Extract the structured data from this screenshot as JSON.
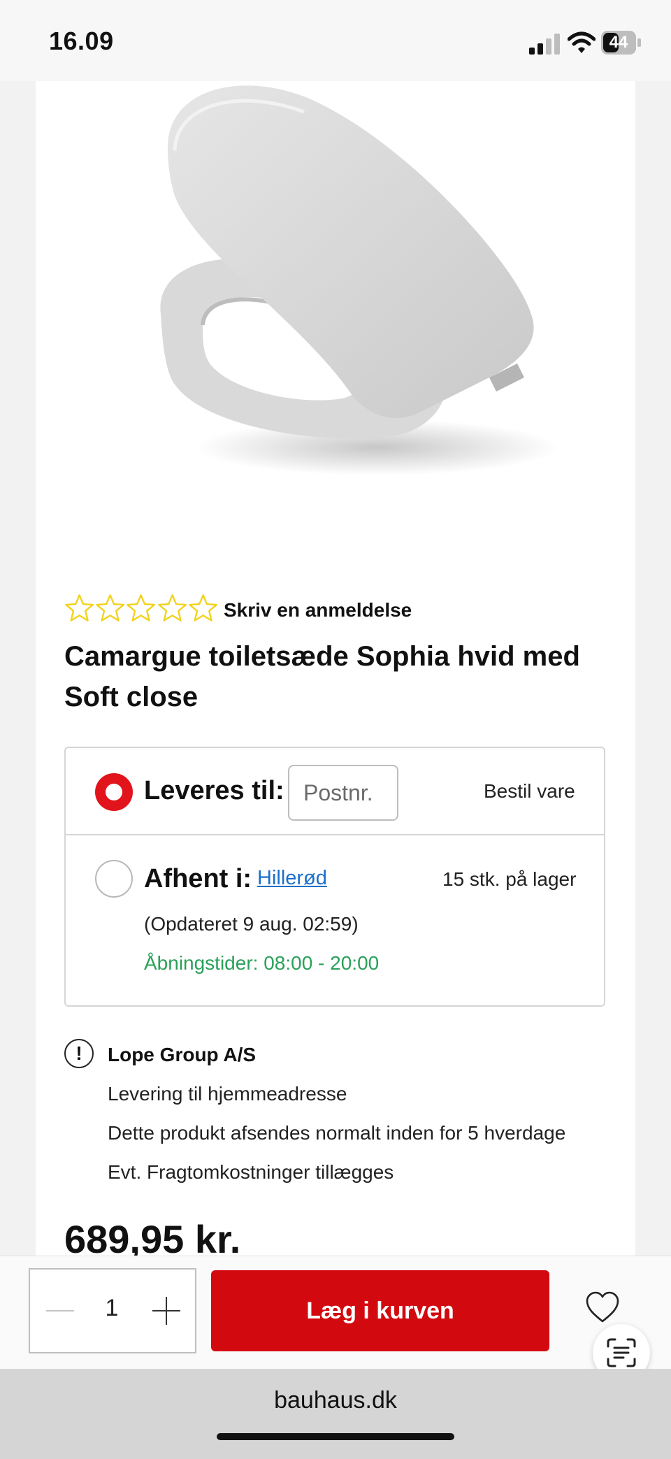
{
  "status_bar": {
    "time": "16.09",
    "battery": "44"
  },
  "product": {
    "review_link": "Skriv en anmeldelse",
    "rating_stars": 0,
    "title": "Camargue toiletsæde Sophia hvid med Soft close",
    "price": "689,95 kr."
  },
  "delivery": {
    "deliver_label": "Leveres til:",
    "postcode_placeholder": "Postnr.",
    "order_text": "Bestil vare",
    "pickup_label": "Afhent i:",
    "store": "Hillerød",
    "stock": "15 stk. på lager",
    "updated": "(Opdateret 9 aug. 02:59)",
    "hours": "Åbningstider: 08:00 - 20:00"
  },
  "seller": {
    "icon": "!",
    "name": "Lope Group A/S",
    "lines": [
      "Levering til hjemmeadresse",
      "Dette produkt afsendes normalt inden for 5 hverdage",
      "Evt. Fragtomkostninger tillægges"
    ]
  },
  "cart": {
    "quantity": "1",
    "add_to_cart": "Læg i kurven"
  },
  "browser": {
    "url": "bauhaus.dk"
  },
  "colors": {
    "accent_red": "#d20a10",
    "link_blue": "#1b6fc9",
    "hours_green": "#2aa05a",
    "star_yellow": "#f2d21b"
  },
  "icons": [
    "signal-icon",
    "wifi-icon",
    "battery-icon",
    "star-icon",
    "info-icon",
    "minus-icon",
    "plus-icon",
    "heart-icon",
    "scan-text-icon"
  ]
}
